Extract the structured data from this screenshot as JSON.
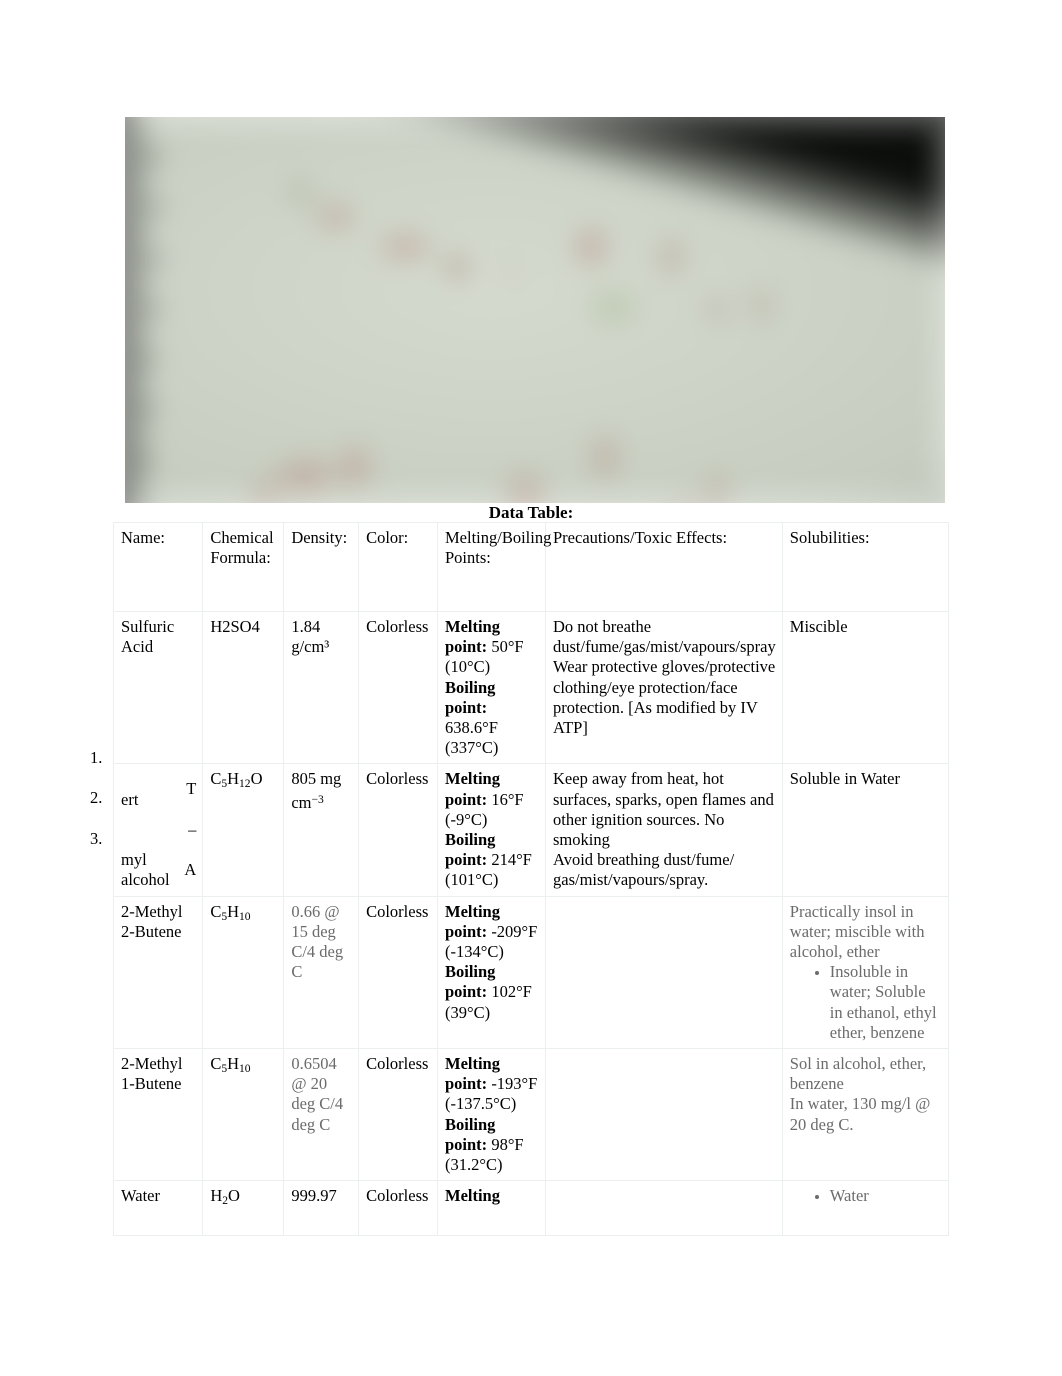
{
  "document": {
    "caption": "Data Table:",
    "photo": {
      "alt_name": "handwritten-notes-photo",
      "description": "Blurred photograph of handwritten chemistry notes in red and green ink on spiral-bound notebook paper"
    }
  },
  "table": {
    "headers": [
      "Name:",
      "Chemical Formula:",
      "Density:",
      "Color:",
      "Melting/Boiling Points:",
      "Precautions/Toxic Effects:",
      "Solubilities:"
    ],
    "list_markers": [
      "1.",
      "2.",
      "3."
    ],
    "rows": [
      {
        "name": "Sulfuric Acid",
        "formula_plain": "H2SO4",
        "density": "1.84 g/cm³",
        "color": "Colorless",
        "melting_label": "Melting point:",
        "melting_value": " 50°F (10°C)",
        "boiling_label": "Boiling point:",
        "boiling_value": " 638.6°F (337°C)",
        "precautions": "Do not breathe dust/fume/gas/mist/vapours/spray\nWear protective gloves/protective clothing/eye protection/face protection. [As modified by IV ATP]",
        "solubility": "Miscible",
        "solubility_bullets": []
      },
      {
        "name_fragments": {
          "right_col": [
            "T",
            "–",
            "A"
          ],
          "left_col": [
            "ert",
            "myl",
            "alcohol"
          ]
        },
        "name": "Tert-Amyl alcohol",
        "formula_parts": {
          "c": "C",
          "c_sub": "5",
          "h": "H",
          "h_sub": "12",
          "o": "O"
        },
        "density_main": "805 mg cm",
        "density_exp": "−3",
        "color": "Colorless",
        "melting_label": "Melting point:",
        "melting_value": " 16°F (-9°C)",
        "boiling_label": "Boiling point:",
        "boiling_value": " 214°F (101°C)",
        "precautions": " Keep away from heat, hot surfaces, sparks, open flames and other ignition sources. No smoking\n Avoid breathing dust/fume/ gas/mist/vapours/spray.",
        "solubility": "Soluble in Water",
        "solubility_bullets": []
      },
      {
        "name": "2-Methyl 2-Butene",
        "formula_parts": {
          "c": "C",
          "c_sub": "5",
          "h": "H",
          "h_sub": "10"
        },
        "density": "0.66 @ 15 deg C/4 deg C",
        "color": "Colorless",
        "melting_label": "Melting point:",
        "melting_value": " -209°F (-134°C)",
        "boiling_label": "Boiling point:",
        "boiling_value": " 102°F (39°C)",
        "precautions": "",
        "solubility": "Practically insol in water; miscible with alcohol, ether",
        "solubility_bullets": [
          "Insoluble in water; Soluble in ethanol, ethyl ether, benzene"
        ]
      },
      {
        "name": "2-Methyl 1-Butene",
        "formula_parts": {
          "c": "C",
          "c_sub": "5",
          "h": "H",
          "h_sub": "10"
        },
        "density": "0.6504 @ 20 deg C/4 deg C",
        "color": "Colorless",
        "melting_label": "Melting point:",
        "melting_value": " -193°F (-137.5°C)",
        "boiling_label": "Boiling point:",
        "boiling_value": " 98°F (31.2°C)",
        "precautions": "",
        "solubility": "Sol in alcohol, ether, benzene\nIn water, 130 mg/l @ 20 deg C.",
        "solubility_bullets": []
      },
      {
        "name": "Water",
        "formula_parts": {
          "h": "H",
          "h_sub": "2",
          "o": "O"
        },
        "density": "999.97",
        "color": "Colorless",
        "melting_label": "Melting",
        "melting_value": "",
        "boiling_label": "",
        "boiling_value": "",
        "precautions": "",
        "solubility": "",
        "solubility_bullets": [
          "Water"
        ]
      }
    ]
  },
  "colors": {
    "page_background": "#ffffff",
    "text": "#000000",
    "muted_text": "#6b6b6b",
    "table_border": "#eceff0"
  }
}
